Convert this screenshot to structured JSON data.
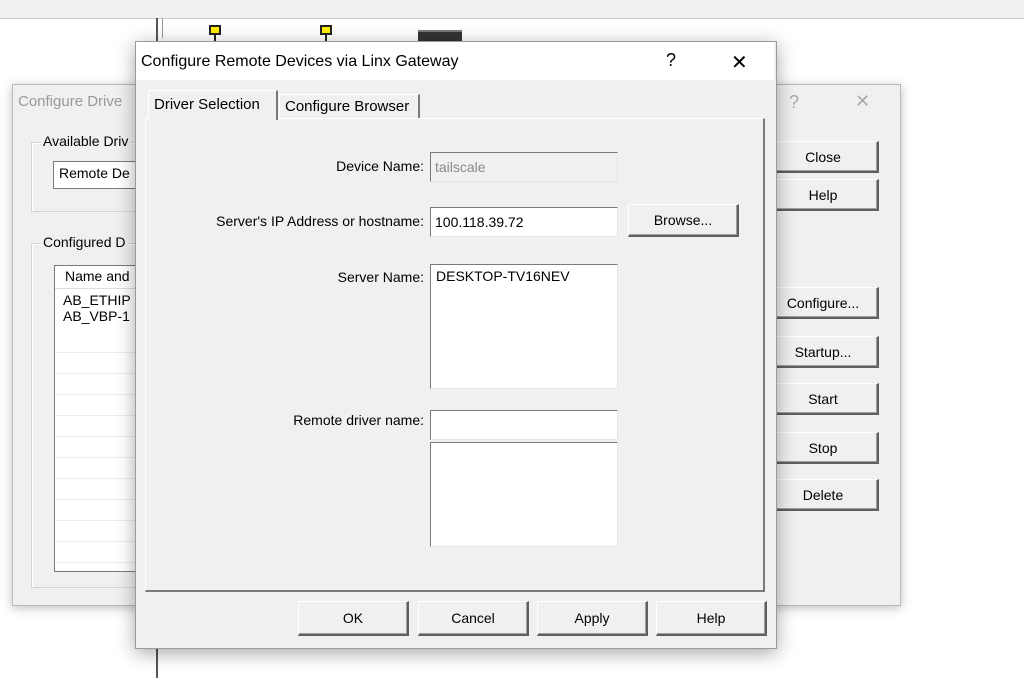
{
  "front_dialog": {
    "title": "Configure Remote Devices via Linx Gateway",
    "help_glyph": "?",
    "close_glyph": "✕",
    "tabs": [
      {
        "label": "Driver Selection",
        "active": true
      },
      {
        "label": "Configure Browser",
        "active": false
      }
    ],
    "form": {
      "device_name_label": "Device Name:",
      "device_name_value": "tailscale",
      "server_ip_label": "Server's IP Address or hostname:",
      "server_ip_value": "100.118.39.72",
      "browse_label": "Browse...",
      "server_name_label": "Server Name:",
      "server_name_value": "DESKTOP-TV16NEV",
      "remote_driver_label": "Remote driver name:",
      "remote_driver_value": "",
      "remote_driver_list": ""
    },
    "buttons": {
      "ok": "OK",
      "cancel": "Cancel",
      "apply": "Apply",
      "help": "Help"
    }
  },
  "back_dialog": {
    "title": "Configure Drive",
    "help_glyph": "?",
    "close_glyph": "✕",
    "available_group_label": "Available Driv",
    "available_select_value": "Remote De",
    "configured_group_label": "Configured D",
    "list_header": "Name and",
    "list_items": [
      "AB_ETHIP",
      "AB_VBP-1"
    ],
    "buttons": {
      "close": "Close",
      "help": "Help",
      "configure": "Configure...",
      "startup": "Startup...",
      "start": "Start",
      "stop": "Stop",
      "delete": "Delete"
    }
  },
  "icons": [
    "network-node-icon",
    "network-node-icon",
    "device-rack-icon"
  ]
}
